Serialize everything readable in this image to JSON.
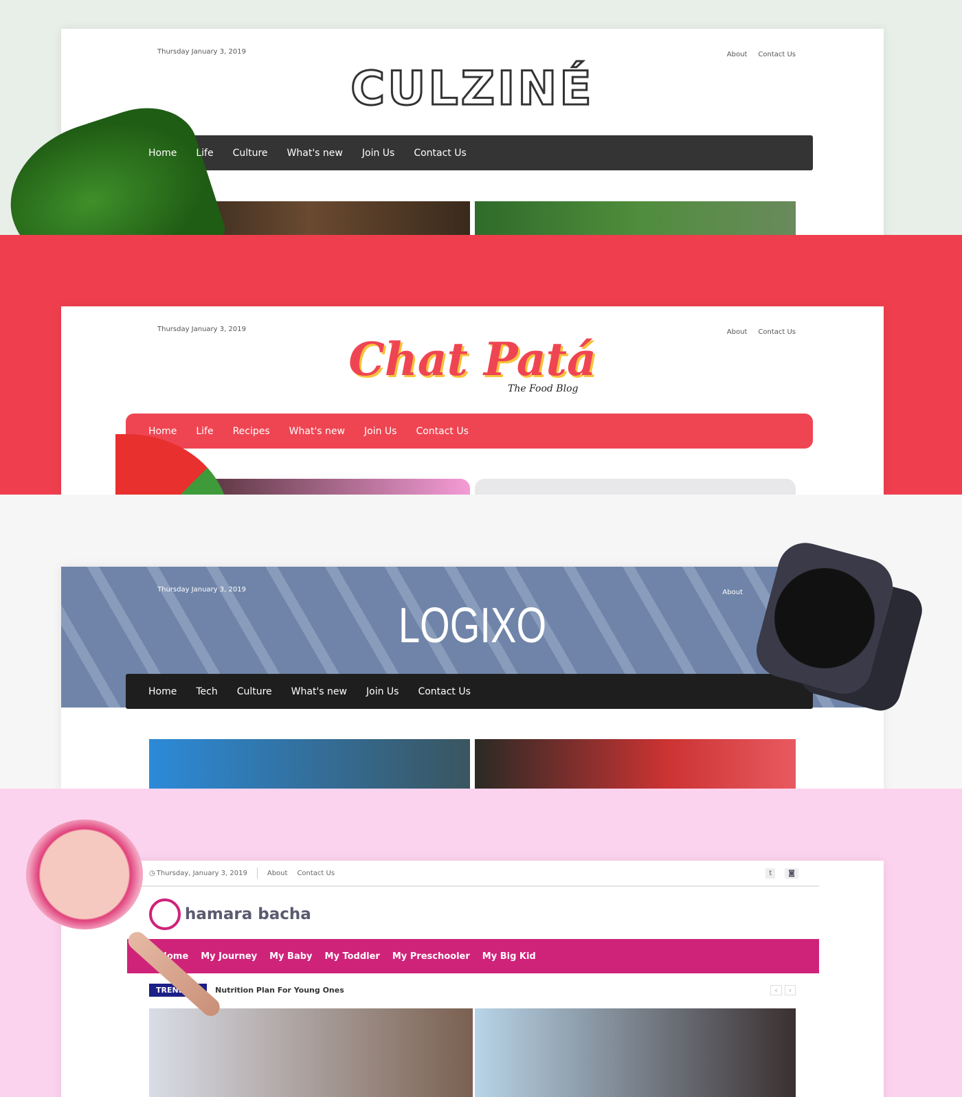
{
  "culzine": {
    "date": "Thursday January 3, 2019",
    "links": [
      "About",
      "Contact Us"
    ],
    "logo": "CULZINÉ",
    "nav": [
      "Home",
      "Life",
      "Culture",
      "What's new",
      "Join Us",
      "Contact Us"
    ],
    "bg": "#e8eee8",
    "nav_color": "#343434"
  },
  "chatpata": {
    "date": "Thursday January 3, 2019",
    "links": [
      "About",
      "Contact Us"
    ],
    "logo": "Chat Patá",
    "tagline": "The Food Blog",
    "nav": [
      "Home",
      "Life",
      "Recipes",
      "What's new",
      "Join Us",
      "Contact Us"
    ],
    "bg": "#ef3f4f",
    "nav_color": "#ef4552"
  },
  "logixo": {
    "date": "Thursday January 3, 2019",
    "links": [
      "About"
    ],
    "logo": "LOGIXO",
    "nav": [
      "Home",
      "Tech",
      "Culture",
      "What's new",
      "Join Us",
      "Contact Us"
    ],
    "bg": "#f6f6f6",
    "banner_color": "#6f84a8",
    "nav_color": "#1e1e1e"
  },
  "hamara": {
    "date": "Thursday, January 3, 2019",
    "links": [
      "About",
      "Contact Us"
    ],
    "logo": "hamara bacha",
    "nav": [
      "Home",
      "My Journey",
      "My Baby",
      "My Toddler",
      "My Preschooler",
      "My Big Kid"
    ],
    "trending_label": "TRENDING",
    "trending_text": "Nutrition Plan For Young Ones",
    "social": [
      "twitter-icon",
      "instagram-icon"
    ],
    "bg": "#fcd3ee",
    "nav_color": "#cf2379"
  }
}
